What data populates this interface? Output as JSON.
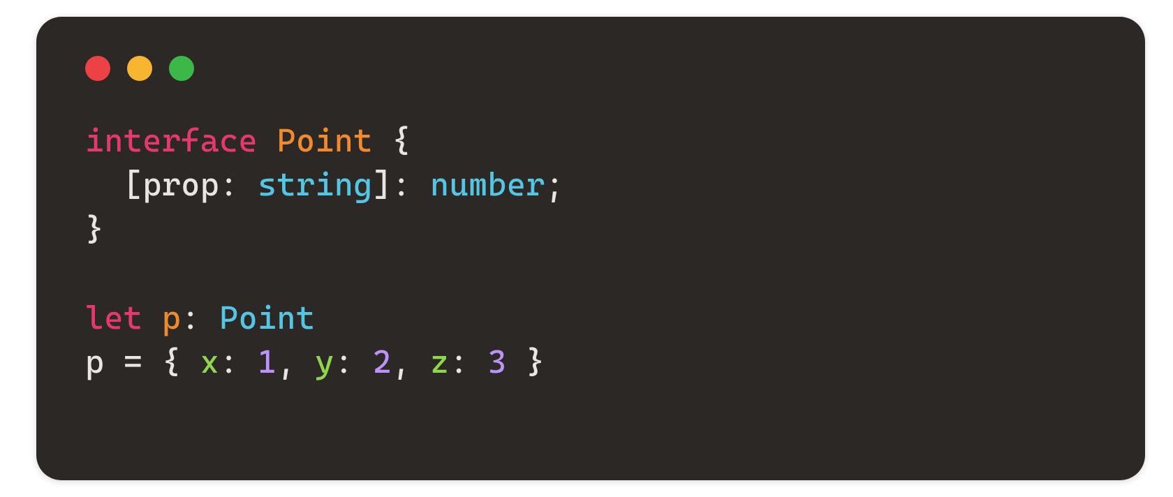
{
  "theme": {
    "bg": "#2b2825",
    "text": "#e8e6e3",
    "keyword": "#e5396e",
    "class": "#f08a2c",
    "type": "#55c5e4",
    "property": "#8fd64e",
    "number": "#bd93f9",
    "traffic_red": "#ed4245",
    "traffic_yellow": "#f7b531",
    "traffic_green": "#3cb848"
  },
  "code": {
    "kw_interface": "interface",
    "class_point": "Point",
    "brace_open": "{",
    "index_open": "  [prop: ",
    "type_string": "string",
    "index_mid": "]: ",
    "type_number": "number",
    "semicolon": ";",
    "brace_close": "}",
    "kw_let": "let",
    "var_p": "p",
    "colon": ": ",
    "type_point": "Point",
    "assign_lhs": "p = { ",
    "prop_x": "x",
    "val_1": "1",
    "prop_y": "y",
    "val_2": "2",
    "prop_z": "z",
    "val_3": "3",
    "sep": ": ",
    "comma": ", ",
    "assign_close": " }"
  }
}
